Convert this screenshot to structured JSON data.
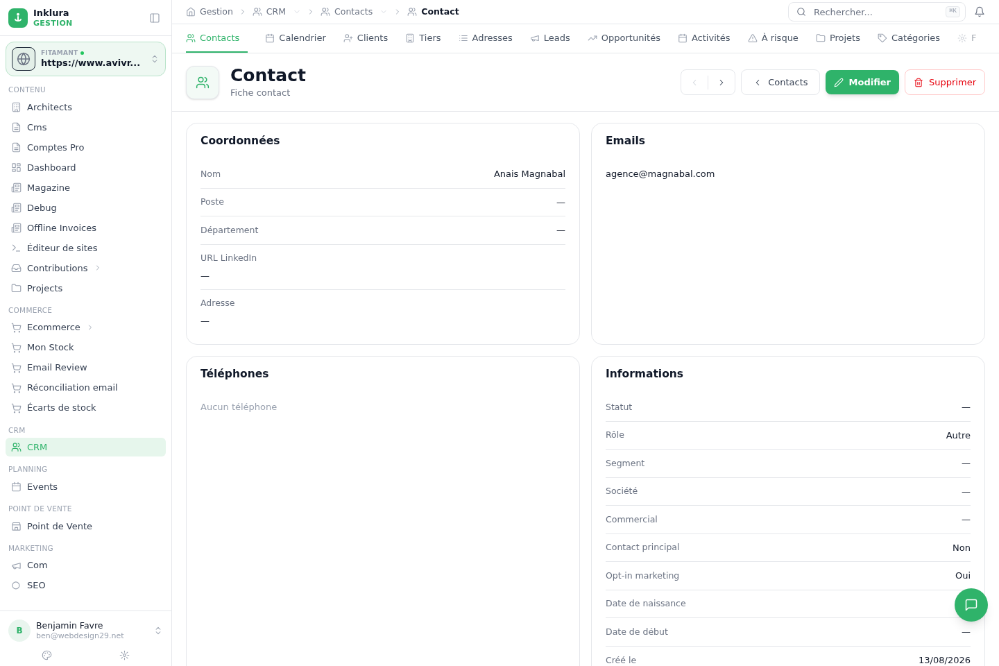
{
  "brand": {
    "name": "Inklura",
    "subtitle": "GESTION"
  },
  "workspace": {
    "label": "FITAMANT",
    "online": true,
    "url": "https://www.avivr..."
  },
  "sidebar": {
    "sections": [
      {
        "title": "CONTENU",
        "items": [
          {
            "label": "Architects",
            "selected": false,
            "has_submenu": false
          },
          {
            "label": "Cms",
            "selected": false,
            "has_submenu": false
          },
          {
            "label": "Comptes Pro",
            "selected": false,
            "has_submenu": false
          },
          {
            "label": "Dashboard",
            "selected": false,
            "has_submenu": false
          },
          {
            "label": "Magazine",
            "selected": false,
            "has_submenu": false
          },
          {
            "label": "Debug",
            "selected": false,
            "has_submenu": false
          },
          {
            "label": "Offline Invoices",
            "selected": false,
            "has_submenu": false
          },
          {
            "label": "Éditeur de sites",
            "selected": false,
            "has_submenu": false
          },
          {
            "label": "Contributions",
            "selected": false,
            "has_submenu": true
          },
          {
            "label": "Projects",
            "selected": false,
            "has_submenu": false
          }
        ]
      },
      {
        "title": "COMMERCE",
        "items": [
          {
            "label": "Ecommerce",
            "selected": false,
            "has_submenu": true
          },
          {
            "label": "Mon Stock",
            "selected": false,
            "has_submenu": false
          },
          {
            "label": "Email Review",
            "selected": false,
            "has_submenu": false
          },
          {
            "label": "Réconciliation email",
            "selected": false,
            "has_submenu": false
          },
          {
            "label": "Écarts de stock",
            "selected": false,
            "has_submenu": false
          }
        ]
      },
      {
        "title": "CRM",
        "items": [
          {
            "label": "CRM",
            "selected": true,
            "has_submenu": false
          }
        ]
      },
      {
        "title": "PLANNING",
        "items": [
          {
            "label": "Events",
            "selected": false,
            "has_submenu": false
          }
        ]
      },
      {
        "title": "POINT DE VENTE",
        "items": [
          {
            "label": "Point de Vente",
            "selected": false,
            "has_submenu": false
          }
        ]
      },
      {
        "title": "MARKETING",
        "items": [
          {
            "label": "Com",
            "selected": false,
            "has_submenu": false
          },
          {
            "label": "SEO",
            "selected": false,
            "has_submenu": false
          }
        ]
      }
    ]
  },
  "user": {
    "initial": "B",
    "name": "Benjamin Favre",
    "email": "ben@webdesign29.net"
  },
  "breadcrumb": [
    {
      "label": "Gestion",
      "dropdown": false,
      "current": false
    },
    {
      "label": "CRM",
      "dropdown": true,
      "current": false
    },
    {
      "label": "Contacts",
      "dropdown": true,
      "current": false
    },
    {
      "label": "Contact",
      "dropdown": false,
      "current": true
    }
  ],
  "search": {
    "placeholder": "Rechercher...",
    "shortcut": "⌘K"
  },
  "tabs": [
    {
      "label": "Contacts",
      "selected": true,
      "faded": false
    },
    {
      "label": "Calendrier",
      "selected": false,
      "faded": false
    },
    {
      "label": "Clients",
      "selected": false,
      "faded": false
    },
    {
      "label": "Tiers",
      "selected": false,
      "faded": false
    },
    {
      "label": "Adresses",
      "selected": false,
      "faded": false
    },
    {
      "label": "Leads",
      "selected": false,
      "faded": false
    },
    {
      "label": "Opportunités",
      "selected": false,
      "faded": false
    },
    {
      "label": "Activités",
      "selected": false,
      "faded": false
    },
    {
      "label": "À risque",
      "selected": false,
      "faded": false
    },
    {
      "label": "Projets",
      "selected": false,
      "faded": false
    },
    {
      "label": "Catégories",
      "selected": false,
      "faded": false
    },
    {
      "label": "F",
      "selected": false,
      "faded": true
    }
  ],
  "header": {
    "title": "Contact",
    "subtitle": "Fiche contact"
  },
  "actions": {
    "prev_disabled": true,
    "next_disabled": false,
    "back": "Contacts",
    "edit": "Modifier",
    "delete": "Supprimer"
  },
  "cards": [
    {
      "title": "Coordonnées",
      "kind": "fields",
      "fields": [
        {
          "label": "Nom",
          "value": "Anais Magnabal",
          "kind": "inline"
        },
        {
          "label": "Poste",
          "value": "—",
          "kind": "inline"
        },
        {
          "label": "Département",
          "value": "—",
          "kind": "inline"
        },
        {
          "label": "URL LinkedIn",
          "value": "—",
          "kind": "stacked"
        },
        {
          "label": "Adresse",
          "value": "—",
          "kind": "stacked"
        }
      ]
    },
    {
      "title": "Emails",
      "kind": "list",
      "items": [
        "agence@magnabal.com"
      ]
    },
    {
      "title": "Téléphones",
      "kind": "empty",
      "empty_text": "Aucun téléphone"
    },
    {
      "title": "Informations",
      "kind": "fields",
      "fields": [
        {
          "label": "Statut",
          "value": "—",
          "kind": "inline"
        },
        {
          "label": "Rôle",
          "value": "Autre",
          "kind": "inline"
        },
        {
          "label": "Segment",
          "value": "—",
          "kind": "inline"
        },
        {
          "label": "Société",
          "value": "—",
          "kind": "inline"
        },
        {
          "label": "Commercial",
          "value": "—",
          "kind": "inline"
        },
        {
          "label": "Contact principal",
          "value": "Non",
          "kind": "inline"
        },
        {
          "label": "Opt-in marketing",
          "value": "Oui",
          "kind": "inline"
        },
        {
          "label": "Date de naissance",
          "kind": "inline"
        },
        {
          "label": "Date de début",
          "value": "—",
          "kind": "inline"
        },
        {
          "label": "Créé le",
          "value": "13/08/2026",
          "kind": "inline"
        }
      ]
    }
  ]
}
